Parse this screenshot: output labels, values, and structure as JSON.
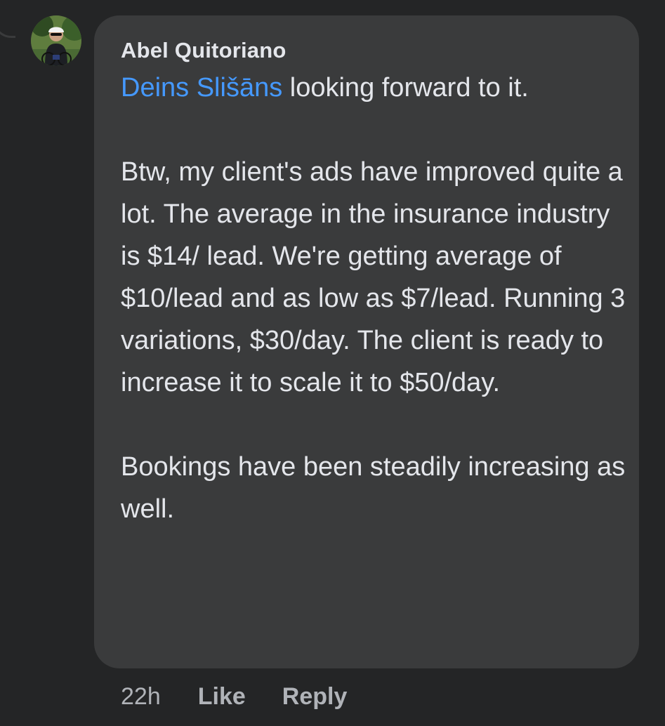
{
  "comment": {
    "author": "Abel Quitoriano",
    "mention": "Deins Slišāns",
    "text_line1_rest": " looking forward to it.",
    "paragraph2": "Btw, my client's ads have improved quite a lot. The average in the insurance industry is $14/ lead. We're getting average of $10/lead and as low as $7/lead. Running 3 variations, $30/day. The client is ready to increase it to scale it to $50/day.",
    "paragraph3": "Bookings have been steadily increasing as well."
  },
  "actions": {
    "timestamp": "22h",
    "like_label": "Like",
    "reply_label": "Reply"
  },
  "colors": {
    "background": "#242526",
    "bubble": "#3a3b3c",
    "text": "#e4e6eb",
    "mention": "#4599ff",
    "secondary": "#b0b3b8"
  },
  "icons": {
    "avatar": "profile-photo-cyclist"
  }
}
